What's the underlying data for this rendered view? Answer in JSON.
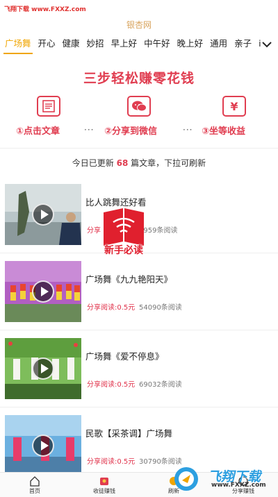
{
  "watermark_top": "飞翔下载 www.FXXZ.com",
  "header": {
    "title": "银杏网"
  },
  "tabs": [
    "广场舞",
    "开心",
    "健康",
    "妙招",
    "早上好",
    "中午好",
    "晚上好",
    "通用",
    "亲子",
    "i"
  ],
  "banner": {
    "title": "三步轻松赚零花钱",
    "steps": [
      {
        "label": "①点击文章",
        "icon": "article-icon"
      },
      {
        "label": "②分享到微信",
        "icon": "wechat-icon"
      },
      {
        "label": "③坐等收益",
        "icon": "yuan-icon",
        "symbol": "¥"
      }
    ],
    "dots": "···"
  },
  "update": {
    "prefix": "今日已更新",
    "count": "68",
    "suffix": "篇文章，下拉可刷新"
  },
  "articles": [
    {
      "title": "比人跳舞还好看",
      "share": "分享",
      "reads": "9959条阅读"
    },
    {
      "title": "广场舞《九九艳阳天》",
      "share": "分享阅读:0.5元",
      "reads": "54090条阅读"
    },
    {
      "title": "广场舞《爱不停息》",
      "share": "分享阅读:0.5元",
      "reads": "69032条阅读"
    },
    {
      "title": "民歌【采茶调】广场舞",
      "share": "分享阅读:0.5元",
      "reads": "30790条阅读"
    }
  ],
  "overlay": {
    "label": "新手必读"
  },
  "bottom_nav": [
    {
      "label": "首页",
      "icon": "home-icon"
    },
    {
      "label": "收徒赚钱",
      "icon": "apprentice-icon"
    },
    {
      "label": "刷新",
      "icon": "refresh-icon"
    },
    {
      "label": "分享赚钱",
      "icon": "share-icon"
    }
  ],
  "watermark_bottom": {
    "text": "飞翔下载",
    "url": "www.FXXZ.com"
  },
  "colors": {
    "accent": "#f0a500",
    "brand_red": "#e03d50",
    "title_gold": "#d8a35c"
  }
}
